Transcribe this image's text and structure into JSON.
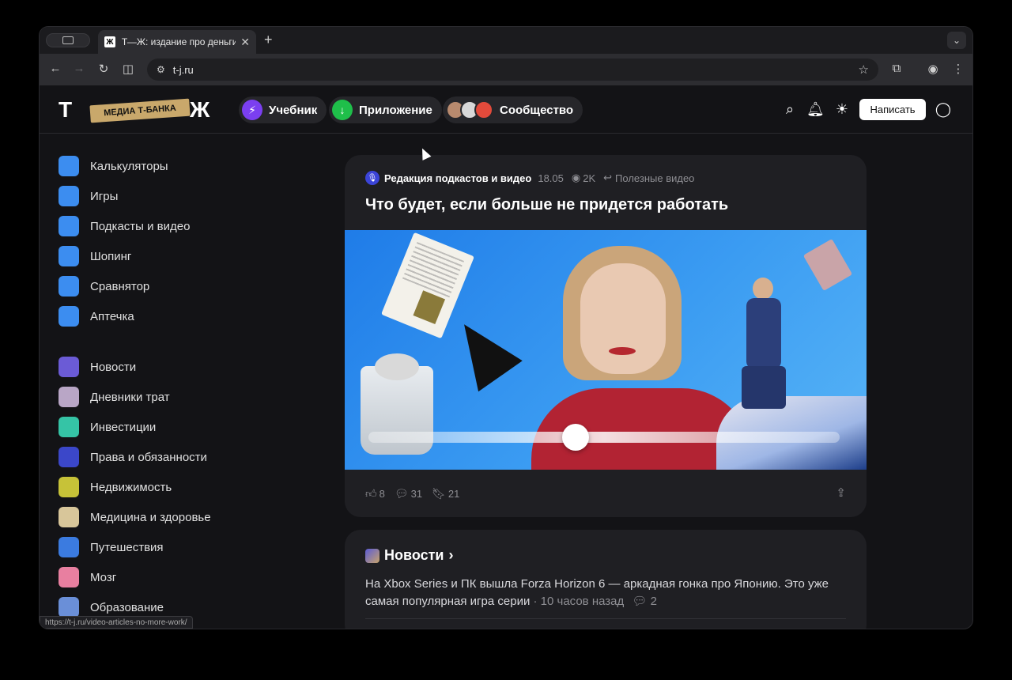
{
  "browser": {
    "tab_title": "Т—Ж: издание про деньги и",
    "tab_favicon": "Ж",
    "url": "t-j.ru",
    "status_url": "https://t-j.ru/video-articles-no-more-work/"
  },
  "header": {
    "logo_left": "Т",
    "logo_badge": "МЕДИА Т-БАНКА",
    "logo_right": "Ж",
    "nav": [
      {
        "label": "Учебник",
        "icon": "lightning-icon",
        "color": "#7b3ff0"
      },
      {
        "label": "Приложение",
        "icon": "download-arrow-icon",
        "color": "#1fbf4a"
      },
      {
        "label": "Сообщество",
        "icon": "avatars"
      }
    ],
    "write_label": "Написать"
  },
  "leftnav": {
    "group1": [
      {
        "label": "Калькуляторы",
        "color": "#3c8df0"
      },
      {
        "label": "Игры",
        "color": "#3c8df0"
      },
      {
        "label": "Подкасты и видео",
        "color": "#3c8df0"
      },
      {
        "label": "Шопинг",
        "color": "#3c8df0"
      },
      {
        "label": "Сравнятор",
        "color": "#3c8df0"
      },
      {
        "label": "Аптечка",
        "color": "#3c8df0"
      }
    ],
    "group2": [
      {
        "label": "Новости",
        "color": "#6b5bd6"
      },
      {
        "label": "Дневники трат",
        "color": "#b9a6c6"
      },
      {
        "label": "Инвестиции",
        "color": "#35c4a6"
      },
      {
        "label": "Права и обязанности",
        "color": "#3b47c9"
      },
      {
        "label": "Недвижимость",
        "color": "#c7c238"
      },
      {
        "label": "Медицина и здоровье",
        "color": "#d8c69a"
      },
      {
        "label": "Путешествия",
        "color": "#3b7be0"
      },
      {
        "label": "Мозг",
        "color": "#e87fa0"
      },
      {
        "label": "Образование",
        "color": "#6a8fd8"
      }
    ]
  },
  "article": {
    "author": "Редакция подкастов и видео",
    "date": "18.05",
    "views": "2K",
    "category": "Полезные видео",
    "title": "Что будет, если больше не придется работать",
    "slider_value": 0.44,
    "likes": "8",
    "comments": "31",
    "bookmarks": "21"
  },
  "news": {
    "section": "Новости",
    "chevron": "›",
    "text": "На Xbox Series и ПК вышла Forza Horizon 6 — аркадная гонка про Японию. Это уже самая популярная игра серии",
    "time": "· 10 часов назад",
    "comments": "2"
  }
}
